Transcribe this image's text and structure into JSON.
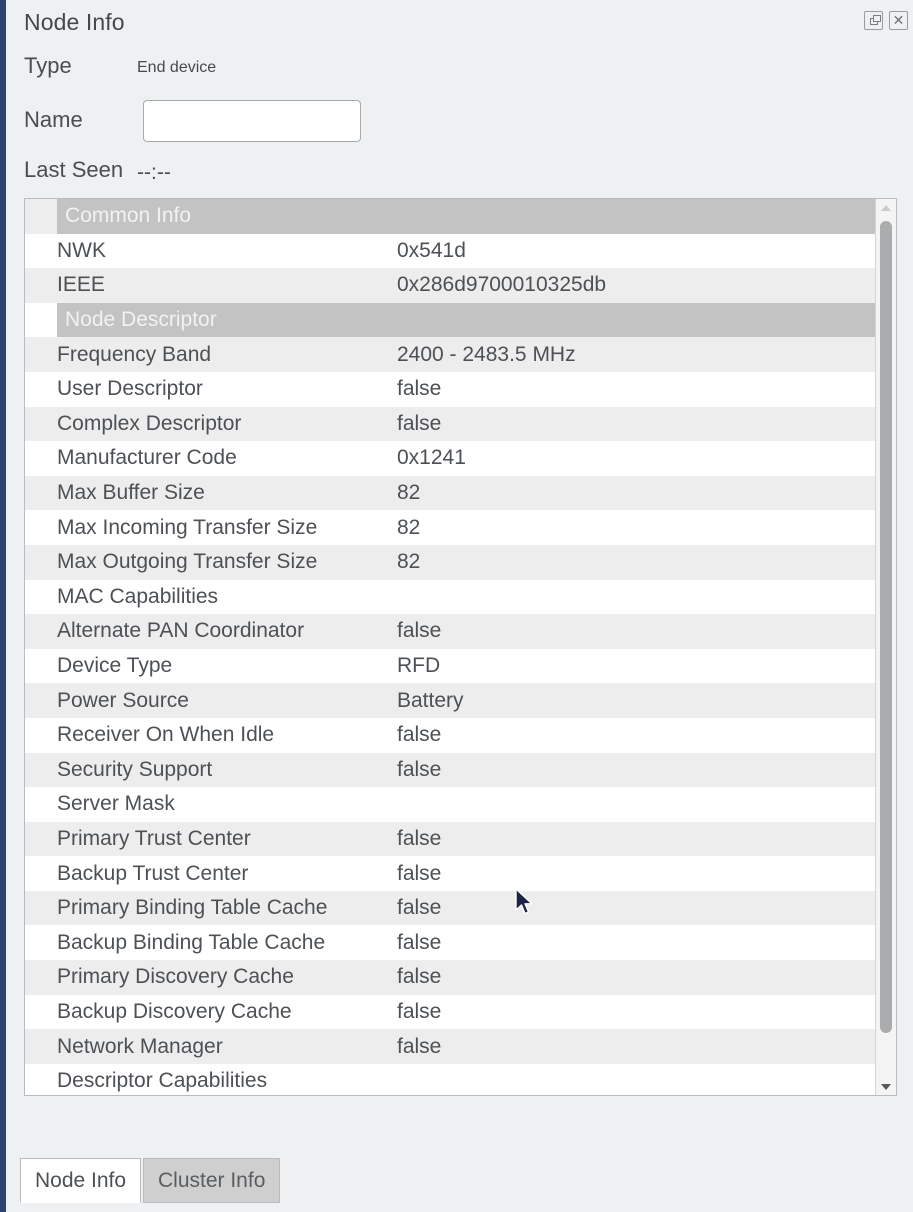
{
  "window": {
    "title": "Node Info",
    "buttons": [
      {
        "name": "float-icon",
        "label": ""
      },
      {
        "name": "close-icon",
        "label": "✕"
      }
    ]
  },
  "form": {
    "type_label": "Type",
    "type_value": "End device",
    "name_label": "Name",
    "name_value": "",
    "name_placeholder": "",
    "last_seen_label": "Last Seen",
    "last_seen_value": "--:--"
  },
  "tree": {
    "rows": [
      {
        "key": "Common Info",
        "value": "",
        "kind": "group",
        "indent": 32
      },
      {
        "key": "NWK",
        "value": "0x541d",
        "kind": "item",
        "indent": 24
      },
      {
        "key": "IEEE",
        "value": "0x286d9700010325db",
        "kind": "item",
        "indent": 24
      },
      {
        "key": "Node Descriptor",
        "value": "",
        "kind": "group",
        "indent": 32
      },
      {
        "key": "Frequency Band",
        "value": "2400 - 2483.5 MHz",
        "kind": "item",
        "indent": 24
      },
      {
        "key": "User Descriptor",
        "value": "false",
        "kind": "item",
        "indent": 24
      },
      {
        "key": "Complex Descriptor",
        "value": "false",
        "kind": "item",
        "indent": 24
      },
      {
        "key": "Manufacturer Code",
        "value": "0x1241",
        "kind": "item",
        "indent": 24
      },
      {
        "key": "Max Buffer Size",
        "value": "82",
        "kind": "item",
        "indent": 24
      },
      {
        "key": "Max Incoming Transfer Size",
        "value": "82",
        "kind": "item",
        "indent": 24
      },
      {
        "key": "Max Outgoing Transfer Size",
        "value": "82",
        "kind": "item",
        "indent": 24
      },
      {
        "key": "MAC Capabilities",
        "value": "",
        "kind": "item",
        "indent": 24
      },
      {
        "key": "Alternate PAN Coordinator",
        "value": "false",
        "kind": "item",
        "indent": 24
      },
      {
        "key": "Device Type",
        "value": "RFD",
        "kind": "item",
        "indent": 24
      },
      {
        "key": "Power Source",
        "value": "Battery",
        "kind": "item",
        "indent": 24
      },
      {
        "key": "Receiver On When Idle",
        "value": "false",
        "kind": "item",
        "indent": 24
      },
      {
        "key": "Security Support",
        "value": "false",
        "kind": "item",
        "indent": 24
      },
      {
        "key": "Server Mask",
        "value": "",
        "kind": "item",
        "indent": 24
      },
      {
        "key": "Primary Trust Center",
        "value": "false",
        "kind": "item",
        "indent": 24
      },
      {
        "key": "Backup Trust Center",
        "value": "false",
        "kind": "item",
        "indent": 24
      },
      {
        "key": "Primary Binding Table Cache",
        "value": "false",
        "kind": "item",
        "indent": 24
      },
      {
        "key": "Backup Binding Table Cache",
        "value": "false",
        "kind": "item",
        "indent": 24
      },
      {
        "key": "Primary Discovery Cache",
        "value": "false",
        "kind": "item",
        "indent": 24
      },
      {
        "key": "Backup Discovery Cache",
        "value": "false",
        "kind": "item",
        "indent": 24
      },
      {
        "key": "Network Manager",
        "value": "false",
        "kind": "item",
        "indent": 24
      },
      {
        "key": "Descriptor Capabilities",
        "value": "",
        "kind": "item",
        "indent": 24
      }
    ]
  },
  "scrollbar": {
    "up_arrow": "scroll-up-arrow",
    "down_arrow": "scroll-down-arrow"
  },
  "tabs": [
    {
      "label": "Node Info",
      "active": true
    },
    {
      "label": "Cluster Info",
      "active": false
    }
  ],
  "colors": {
    "accent": "#2e4270",
    "panel_bg": "#eff0f1",
    "row_even": "#ededed",
    "row_odd": "#ffffff",
    "group_band": "#c3c3c3",
    "text": "#4d5155"
  }
}
